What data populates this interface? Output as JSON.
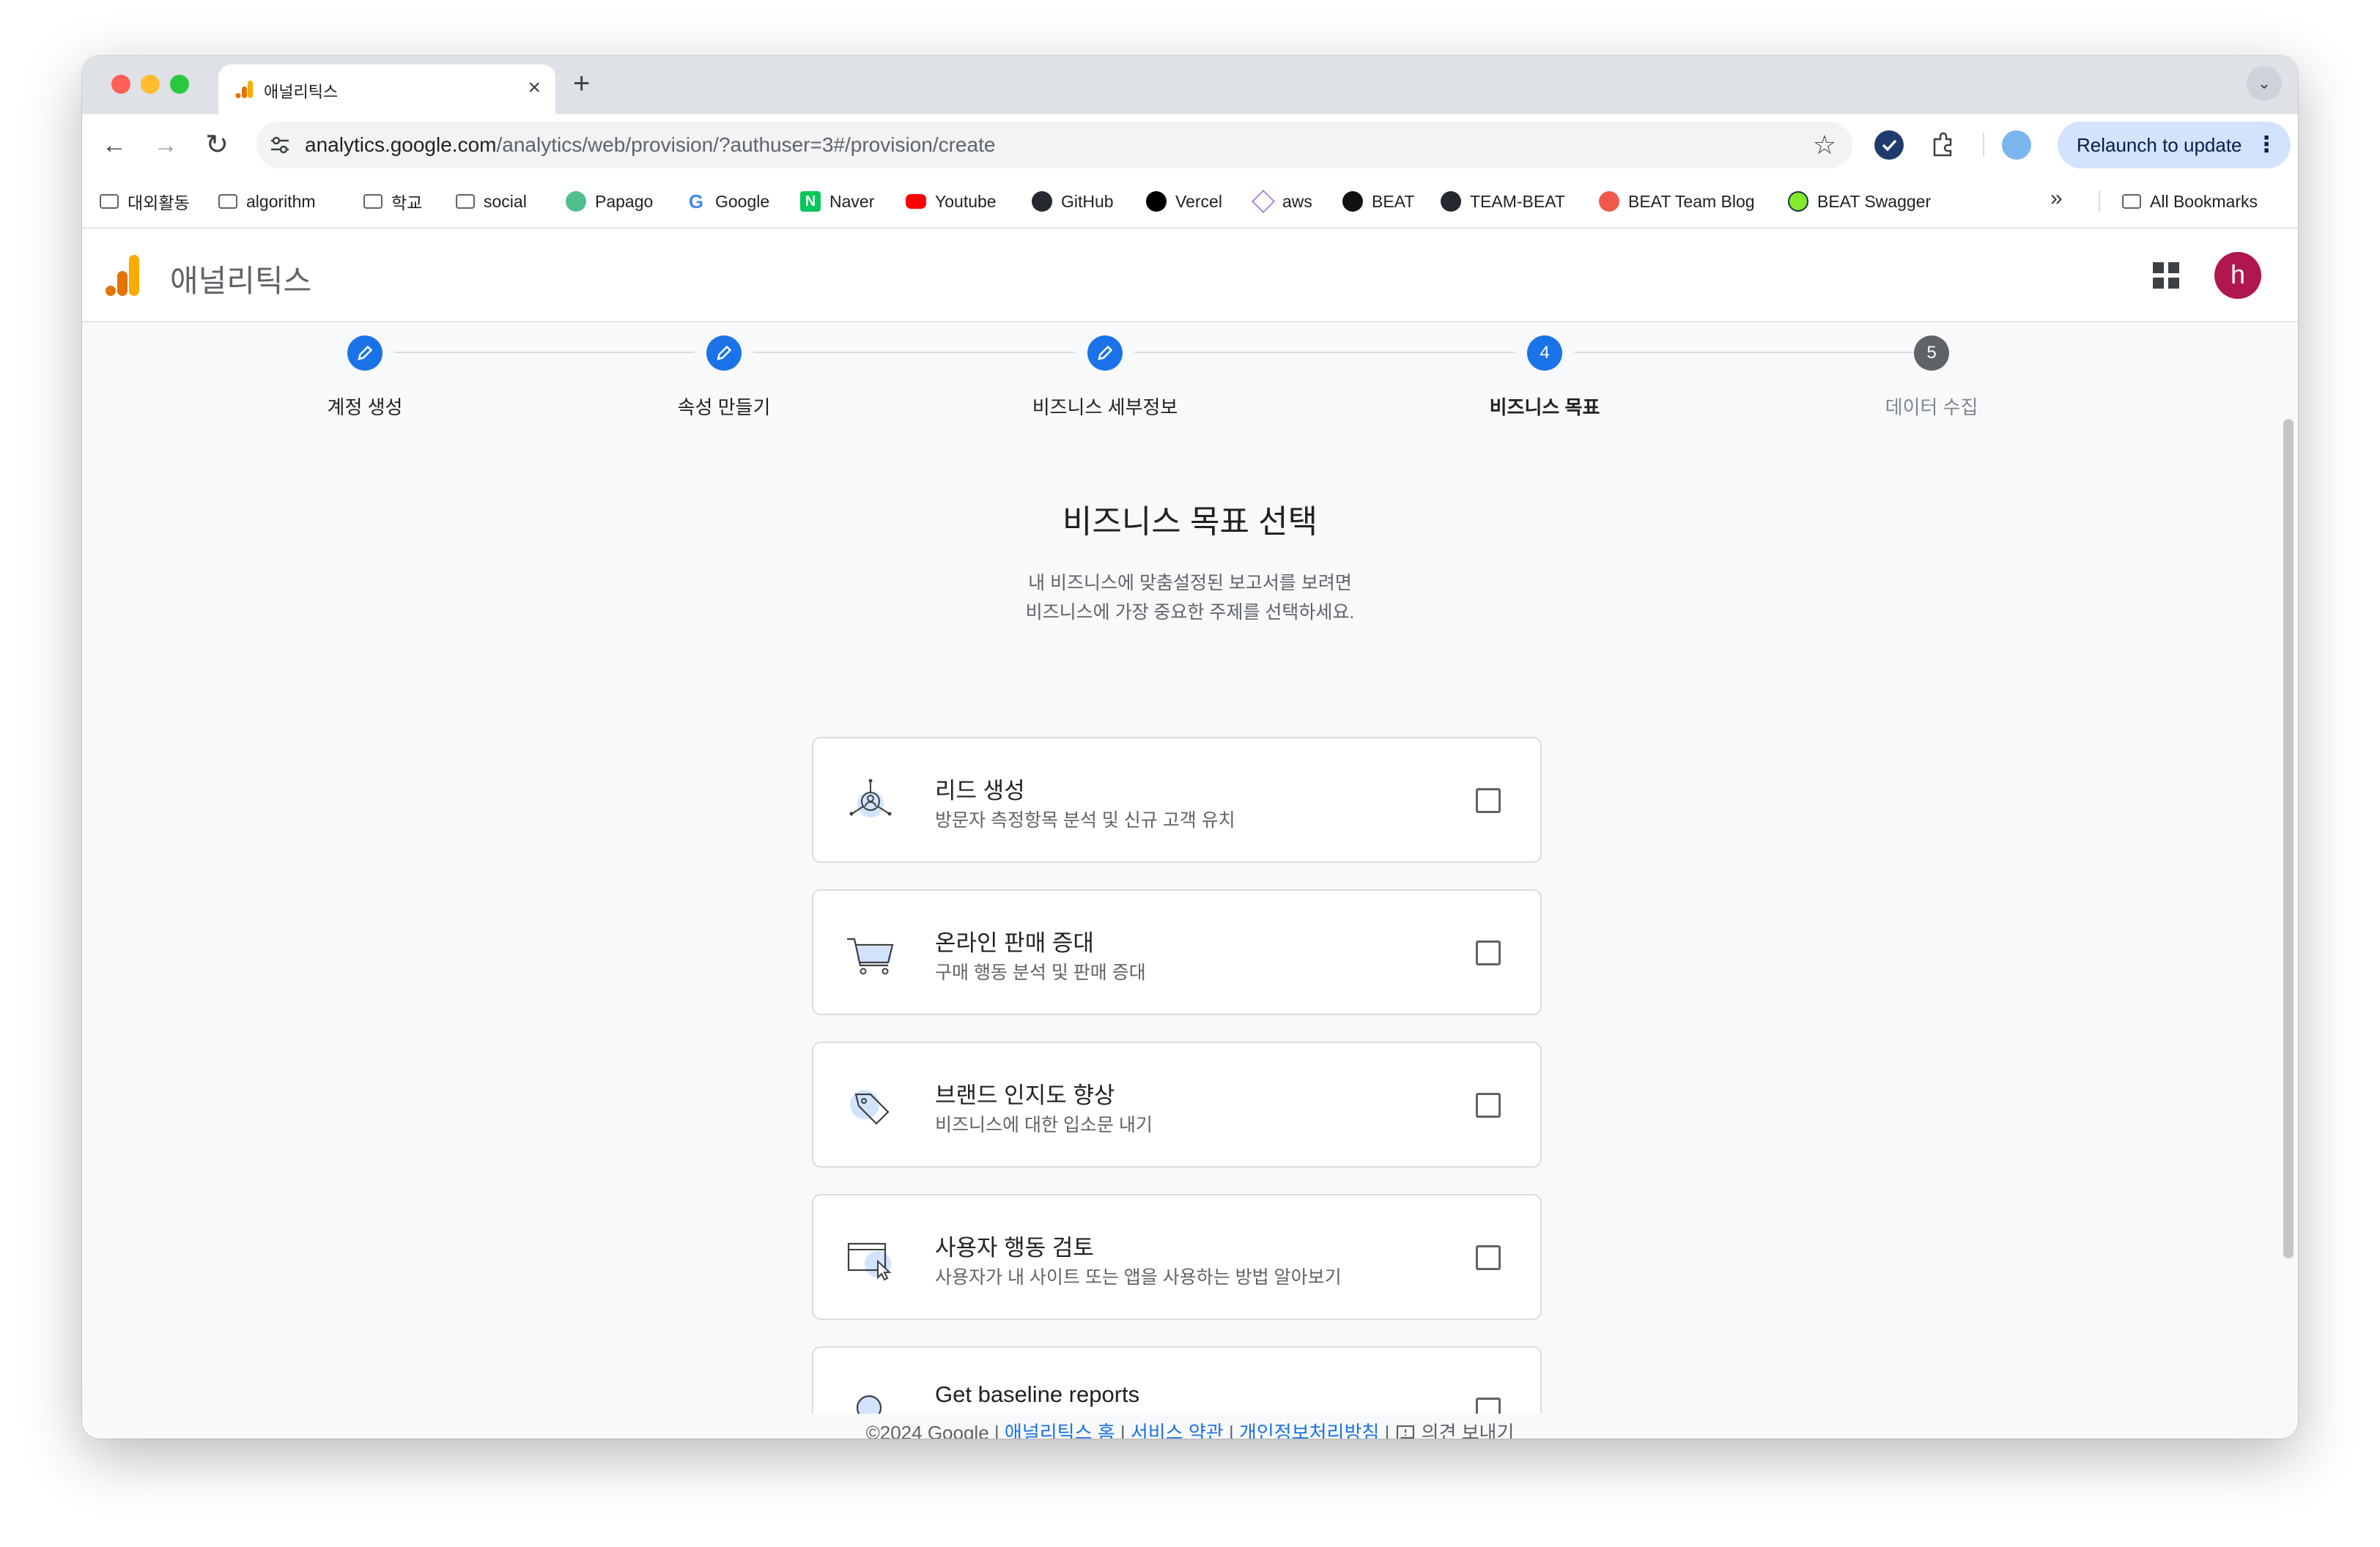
{
  "browser": {
    "tab_title": "애널리틱스",
    "url_host": "analytics.google.com",
    "url_path": "/analytics/web/provision/?authuser=3#/provision/create",
    "relaunch_label": "Relaunch to update"
  },
  "bookmarks": [
    {
      "label": "대외활동",
      "icon": "folder-icon"
    },
    {
      "label": "algorithm",
      "icon": "folder-icon"
    },
    {
      "label": "학교",
      "icon": "folder-icon"
    },
    {
      "label": "social",
      "icon": "folder-icon"
    },
    {
      "label": "Papago",
      "icon": "papago-icon"
    },
    {
      "label": "Google",
      "icon": "google-icon"
    },
    {
      "label": "Naver",
      "icon": "naver-icon"
    },
    {
      "label": "Youtube",
      "icon": "youtube-icon"
    },
    {
      "label": "GitHub",
      "icon": "github-icon"
    },
    {
      "label": "Vercel",
      "icon": "vercel-icon"
    },
    {
      "label": "aws",
      "icon": "aws-icon"
    },
    {
      "label": "BEAT",
      "icon": "beat-icon"
    },
    {
      "label": "TEAM-BEAT",
      "icon": "github-icon"
    },
    {
      "label": "BEAT Team Blog",
      "icon": "blog-icon"
    },
    {
      "label": "BEAT Swagger",
      "icon": "swagger-icon"
    }
  ],
  "all_bookmarks_label": "All Bookmarks",
  "app": {
    "title": "애널리틱스",
    "avatar_letter": "h",
    "brand_color": "#f9ab00",
    "avatar_color": "#b0174f"
  },
  "stepper": {
    "steps": [
      {
        "label": "계정 생성",
        "state": "done"
      },
      {
        "label": "속성 만들기",
        "state": "done"
      },
      {
        "label": "비즈니스 세부정보",
        "state": "done"
      },
      {
        "label": "비즈니스 목표",
        "state": "active",
        "number": "4"
      },
      {
        "label": "데이터 수집",
        "state": "todo",
        "number": "5"
      }
    ]
  },
  "page": {
    "heading": "비즈니스 목표 선택",
    "subtext_line1": "내 비즈니스에 맞춤설정된 보고서를 보려면",
    "subtext_line2": "비즈니스에 가장 중요한 주제를 선택하세요."
  },
  "goals": [
    {
      "title": "리드 생성",
      "desc": "방문자 측정항목 분석 및 신규 고객 유치",
      "icon": "lead-icon",
      "checked": false
    },
    {
      "title": "온라인 판매 증대",
      "desc": "구매 행동 분석 및 판매 증대",
      "icon": "cart-icon",
      "checked": false
    },
    {
      "title": "브랜드 인지도 향상",
      "desc": "비즈니스에 대한 입소문 내기",
      "icon": "tag-icon",
      "checked": false
    },
    {
      "title": "사용자 행동 검토",
      "desc": "사용자가 내 사이트 또는 앱을 사용하는 방법 알아보기",
      "icon": "cursor-window-icon",
      "checked": false
    },
    {
      "title": "Get baseline reports",
      "desc": "",
      "icon": "magnifier-icon",
      "checked": false
    }
  ],
  "footer": {
    "copyright": "©2024 Google",
    "home_link": "애널리틱스 홈",
    "terms_link": "서비스 약관",
    "privacy_link": "개인정보처리방침",
    "feedback": "의견 보내기",
    "separator": "|"
  },
  "colors": {
    "accent": "#1a73e8",
    "step_todo": "#5f6368"
  }
}
